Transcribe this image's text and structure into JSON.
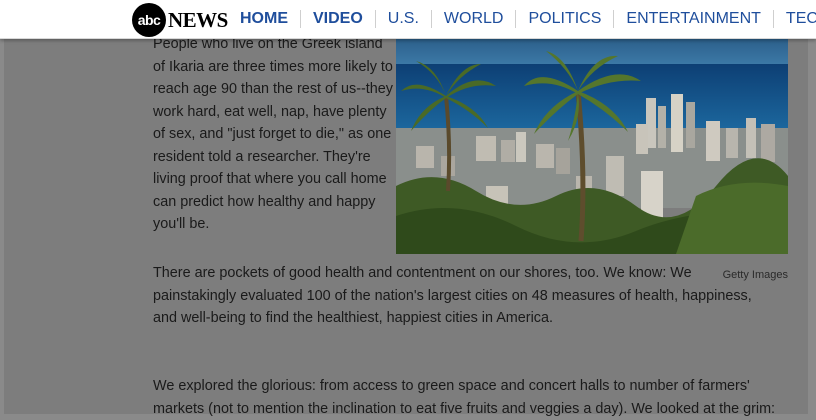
{
  "header": {
    "logo_mark": "abc",
    "logo_word": "NEWS",
    "nav": [
      "HOME",
      "VIDEO",
      "U.S.",
      "WORLD",
      "POLITICS",
      "ENTERTAINMENT",
      "TECH"
    ]
  },
  "article": {
    "intro": "People who live on the Greek island of Ikaria are three times more likely to reach age 90 than the rest of us--they work hard, eat well, nap, have plenty of sex, and \"just forget to die,\" as one resident told a researcher. They're living proof that where you call home can predict how healthy and happy you'll be.",
    "photo_credit": "Getty Images",
    "para2": "There are pockets of good health and contentment on our shores, too. We know: We painstakingly evaluated 100 of the nation's largest cities on 48 measures of health, happiness, and well-being to find the healthiest, happiest cities in America.",
    "para3": "We explored the glorious: from access to green space and concert halls to number of farmers' markets (not to mention the inclination to eat five fruits and veggies a day). We looked at the grim:"
  },
  "colors": {
    "nav_link": "#1f4e9c",
    "page_overlay": "#7d7d7d",
    "text": "#1a1a1a"
  }
}
